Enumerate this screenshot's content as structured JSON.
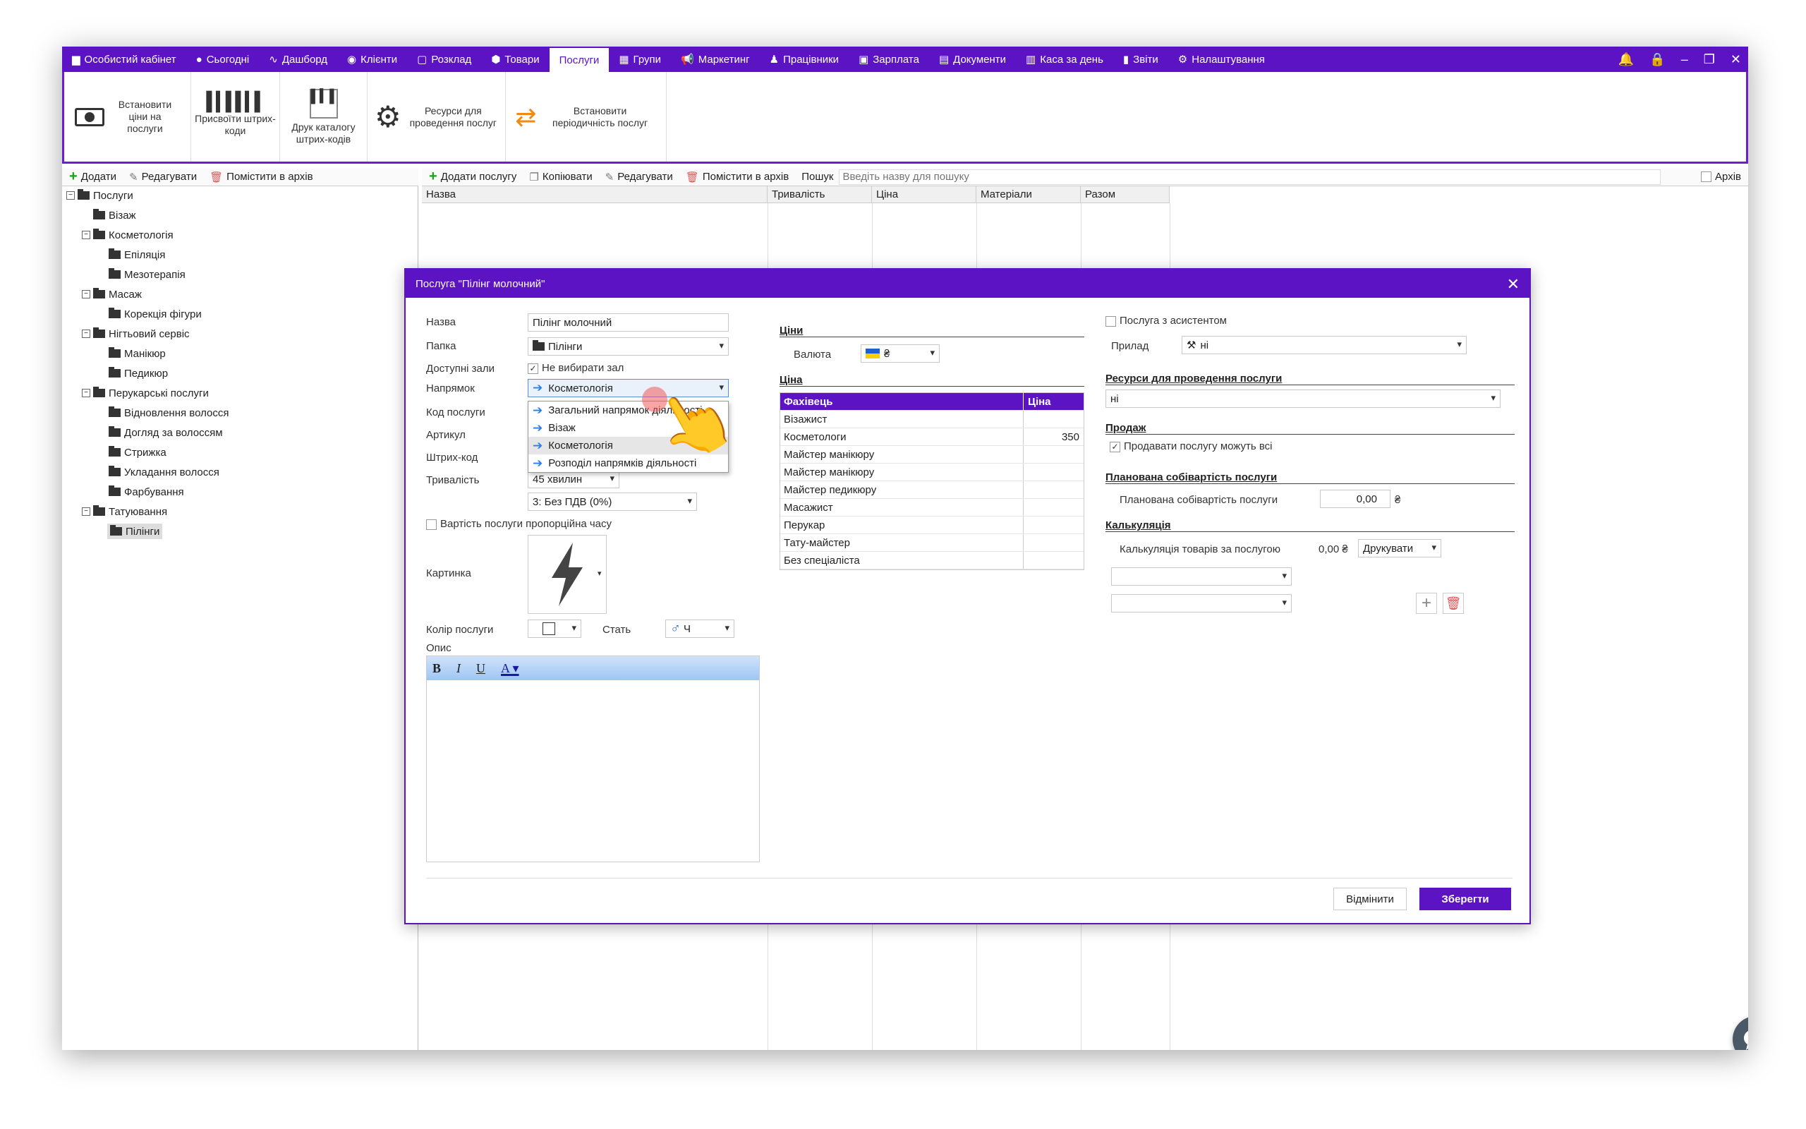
{
  "nav": {
    "tabs": [
      {
        "label": "Особистий кабінет",
        "icon": "cabinet-icon"
      },
      {
        "label": "Сьогодні",
        "icon": "clock-icon"
      },
      {
        "label": "Дашборд",
        "icon": "pulse-icon"
      },
      {
        "label": "Клієнти",
        "icon": "user-circle-icon"
      },
      {
        "label": "Розклад",
        "icon": "calendar-icon"
      },
      {
        "label": "Товари",
        "icon": "box-icon"
      },
      {
        "label": "Послуги",
        "icon": ""
      },
      {
        "label": "Групи",
        "icon": "groups-icon"
      },
      {
        "label": "Маркетинг",
        "icon": "megaphone-icon"
      },
      {
        "label": "Працівники",
        "icon": "person-icon"
      },
      {
        "label": "Зарплата",
        "icon": "money-icon"
      },
      {
        "label": "Документи",
        "icon": "document-icon"
      },
      {
        "label": "Каса за день",
        "icon": "calculator-icon"
      },
      {
        "label": "Звіти",
        "icon": "bar-chart-icon"
      },
      {
        "label": "Налаштування",
        "icon": "gear-icon"
      }
    ]
  },
  "ribbon": {
    "set_prices": "Встановити ціни на послуги",
    "assign_barcodes": "Присвоїти штрих-коди",
    "print_catalog": "Друк каталогу штрих-кодів",
    "resources": "Ресурси для проведення послуг",
    "periodicity": "Встановити періодичність послуг"
  },
  "left_toolbar": {
    "add": "Додати",
    "edit": "Редагувати",
    "archive": "Помістити в архів"
  },
  "right_toolbar": {
    "add": "Додати послугу",
    "copy": "Копіювати",
    "edit": "Редагувати",
    "archive": "Помістити в архів",
    "search_label": "Пошук",
    "search_placeholder": "Введіть назву для пошуку",
    "archive_check": "Архів"
  },
  "tree": {
    "root": "Послуги",
    "n1": "Візаж",
    "n2": "Косметологія",
    "n3": "Епіляція",
    "n4": "Мезотерапія",
    "n5": "Масаж",
    "n6": "Корекція фігури",
    "n7": "Нігтьовий сервіс",
    "n8": "Манікюр",
    "n9": "Педикюр",
    "n10": "Перукарські послуги",
    "n11": "Відновлення волосся",
    "n12": "Догляд за волоссям",
    "n13": "Стрижка",
    "n14": "Укладання волосся",
    "n15": "Фарбування",
    "n16": "Татуювання",
    "n17": "Пілінги"
  },
  "table_headers": {
    "name": "Назва",
    "duration": "Тривалість",
    "price": "Ціна",
    "materials": "Матеріали",
    "total": "Разом"
  },
  "dialog": {
    "title": "Послуга \"Пілінг молочний\"",
    "name_label": "Назва",
    "name_value": "Пілінг молочний",
    "folder_label": "Папка",
    "folder_value": "Пілінги",
    "halls_label": "Доступні зали",
    "halls_value": "Не вибирати зал",
    "direction_label": "Напрямок",
    "direction_value": "Косметологія",
    "code_label": "Код послуги",
    "article_label": "Артикул",
    "barcode_label": "Штрих-код",
    "duration_label": "Тривалість",
    "duration_value": "45 хвилин",
    "vat_value": "3: Без ПДВ (0%)",
    "proportional_label": "Вартість послуги пропорційна часу",
    "picture_label": "Картинка",
    "color_label": "Колір послуги",
    "gender_label": "Стать",
    "gender_value": "Ч",
    "description_label": "Опис",
    "prices_section": "Ціни",
    "currency_label": "Валюта",
    "currency_value": "₴",
    "price_section": "Ціна",
    "grid_head_specialist": "Фахівець",
    "grid_head_price": "Ціна",
    "grid_rows": [
      {
        "name": "Візажист",
        "price": ""
      },
      {
        "name": "Косметологи",
        "price": "350"
      },
      {
        "name": "Майстер манікюру",
        "price": ""
      },
      {
        "name": "Майстер манікюру",
        "price": ""
      },
      {
        "name": "Майстер педикюру",
        "price": ""
      },
      {
        "name": "Масажист",
        "price": ""
      },
      {
        "name": "Перукар",
        "price": ""
      },
      {
        "name": "Тату-майстер",
        "price": ""
      },
      {
        "name": "Без спеціаліста",
        "price": ""
      }
    ],
    "assistant_label": "Послуга з асистентом",
    "device_label": "Прилад",
    "device_value": "ні",
    "resources_section": "Ресурси для проведення послуги",
    "resources_value": "ні",
    "sales_section": "Продаж",
    "sales_check": "Продавати послугу можуть всі",
    "planned_section": "Планована собівартість послуги",
    "planned_label": "Планована собівартість послуги",
    "planned_value": "0,00",
    "planned_currency": "₴",
    "calc_section": "Калькуляція",
    "calc_label": "Калькуляція товарів за послугою",
    "calc_value": "0,00 ₴",
    "print_label": "Друкувати",
    "cancel": "Відмінити",
    "save": "Зберегти",
    "dropdown": [
      "Загальний напрямок діяльності",
      "Візаж",
      "Косметологія",
      "Розподіл напрямків діяльності"
    ]
  }
}
